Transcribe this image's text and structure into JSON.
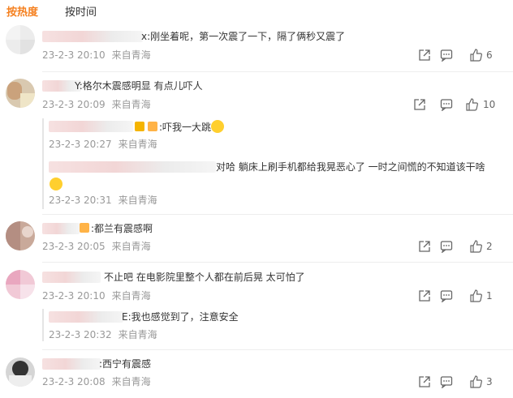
{
  "tabs": {
    "hot": "按热度",
    "time": "按时间"
  },
  "comments": [
    {
      "text": "x:刚坐着呢，第一次震了一下，隔了俩秒又震了",
      "date": "23-2-3 20:10",
      "source": "来自青海",
      "likes": "6"
    },
    {
      "text": "Y:格尔木震感明显   有点儿吓人",
      "date": "23-2-3 20:09",
      "source": "来自青海",
      "likes": "10"
    },
    {
      "text": ":都兰有震感啊",
      "date": "23-2-3 20:05",
      "source": "来自青海",
      "likes": "2"
    },
    {
      "text": "不止吧  在电影院里整个人都在前后晃  太可怕了",
      "date": "23-2-3 20:10",
      "source": "来自青海",
      "likes": "1"
    },
    {
      "text": ":西宁有震感",
      "date": "23-2-3 20:08",
      "source": "来自青海",
      "likes": "3"
    }
  ],
  "replies": [
    {
      "text": ":吓我一大跳",
      "date": "23-2-3 20:27",
      "source": "来自青海"
    },
    {
      "text": "对哈  躺床上刷手机都给我晃恶心了  一时之间慌的不知道该干啥",
      "date": "23-2-3 20:31",
      "source": "来自青海"
    },
    {
      "text": "E:我也感觉到了，注意安全",
      "date": "23-2-3 20:32",
      "source": "来自青海"
    }
  ]
}
